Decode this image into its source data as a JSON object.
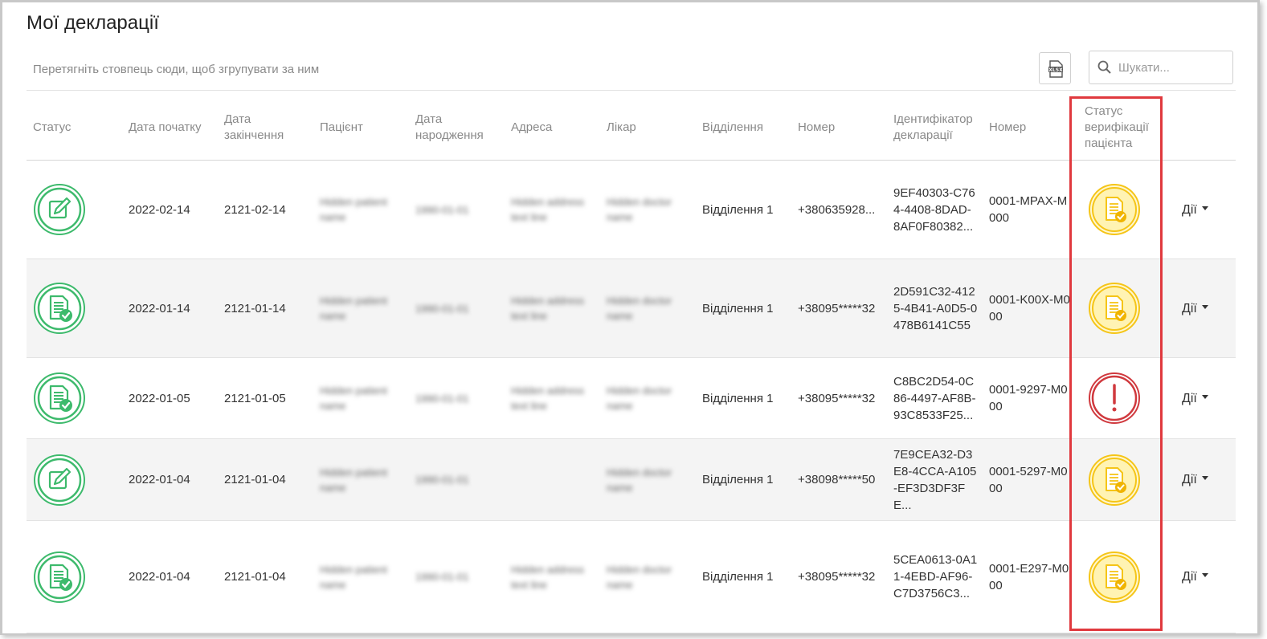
{
  "page": {
    "title": "Мої декларації"
  },
  "toolbar": {
    "group_hint": "Перетягніть стовпець сюди, щоб згрупувати за ним",
    "export_icon": "xlsx-export-icon",
    "search_placeholder": "Шукати...",
    "search_icon": "search-icon"
  },
  "columns": {
    "status": "Статус",
    "start_date": "Дата початку",
    "end_date": "Дата закінчення",
    "patient": "Пацієнт",
    "birth_date": "Дата народження",
    "address": "Адреса",
    "doctor": "Лікар",
    "department": "Відділення",
    "phone": "Номер",
    "declaration_id": "Ідентифікатор декларації",
    "number": "Номер",
    "verification": "Статус верифікації пацієнта"
  },
  "colors": {
    "green": "#3dba6c",
    "yellow": "#f5c518",
    "red": "#d0393e",
    "highlight": "#e0393e"
  },
  "rows": [
    {
      "status_icon": "edit-document-icon",
      "start": "2022-02-14",
      "end": "2121-02-14",
      "patient": "Hidden patient name",
      "birth": "1990-01-01",
      "address": "Hidden address text line",
      "doctor": "Hidden doctor name",
      "department": "Відділення 1",
      "phone": "+380635928...",
      "declaration_id": "9EF40303-C764-4408-8DAD-8AF0F80382...",
      "number": "0001-MPAX-M000",
      "verification": "pending",
      "verification_icon": "document-check-pending-icon",
      "actions": "Дії"
    },
    {
      "status_icon": "document-check-icon",
      "start": "2022-01-14",
      "end": "2121-01-14",
      "patient": "Hidden patient name",
      "birth": "1990-01-01",
      "address": "Hidden address text line",
      "doctor": "Hidden doctor name",
      "department": "Відділення 1",
      "phone": "+38095*****32",
      "declaration_id": "2D591C32-4125-4B41-A0D5-0478B6141C55",
      "number": "0001-K00X-M000",
      "verification": "pending",
      "verification_icon": "document-check-pending-icon",
      "actions": "Дії"
    },
    {
      "status_icon": "document-check-icon",
      "start": "2022-01-05",
      "end": "2121-01-05",
      "patient": "Hidden patient name",
      "birth": "1990-01-01",
      "address": "Hidden address text line",
      "doctor": "Hidden doctor name",
      "department": "Відділення 1",
      "phone": "+38095*****32",
      "declaration_id": "C8BC2D54-0C86-4497-AF8B-93C8533F25...",
      "number": "0001-9297-M000",
      "verification": "error",
      "verification_icon": "exclamation-alert-icon",
      "actions": "Дії"
    },
    {
      "status_icon": "edit-document-icon",
      "start": "2022-01-04",
      "end": "2121-01-04",
      "patient": "Hidden patient name",
      "birth": "1990-01-01",
      "address": "",
      "doctor": "Hidden doctor name",
      "department": "Відділення 1",
      "phone": "+38098*****50",
      "declaration_id": "7E9CEA32-D3E8-4CCA-A105-EF3D3DF3FE...",
      "number": "0001-5297-M000",
      "verification": "pending",
      "verification_icon": "document-check-pending-icon",
      "actions": "Дії"
    },
    {
      "status_icon": "document-check-icon",
      "start": "2022-01-04",
      "end": "2121-01-04",
      "patient": "Hidden patient name",
      "birth": "1990-01-01",
      "address": "Hidden address text line",
      "doctor": "Hidden doctor name",
      "department": "Відділення 1",
      "phone": "+38095*****32",
      "declaration_id": "5CEA0613-0A11-4EBD-AF96-C7D3756C3...",
      "number": "0001-E297-M000",
      "verification": "pending",
      "verification_icon": "document-check-pending-icon",
      "actions": "Дії"
    }
  ]
}
